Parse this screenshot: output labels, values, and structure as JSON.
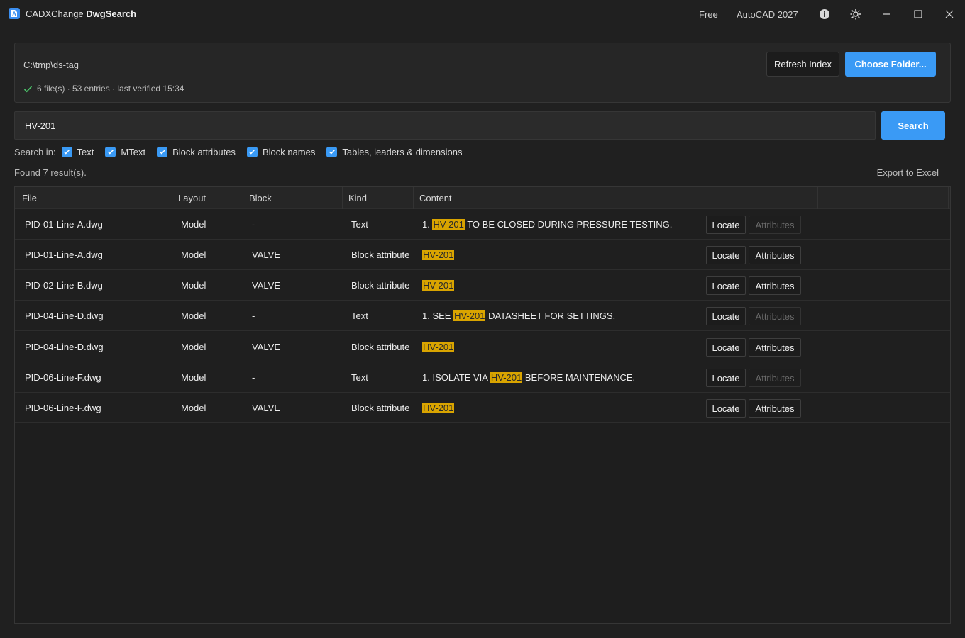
{
  "titlebar": {
    "brand": "CADXChange",
    "product": "DwgSearch",
    "plan": "Free",
    "host": "AutoCAD 2027",
    "icons": [
      "info-icon",
      "theme-icon",
      "minimize-icon",
      "maximize-icon",
      "close-icon"
    ]
  },
  "folder": {
    "path": "C:\\tmp\\ds-tag",
    "status": "6 file(s) · 53 entries · last verified 15:34",
    "refresh_label": "Refresh Index",
    "choose_label": "Choose Folder..."
  },
  "search": {
    "value": "HV-201",
    "button_label": "Search",
    "search_in_label": "Search in:",
    "options": [
      {
        "label": "Text",
        "checked": true
      },
      {
        "label": "MText",
        "checked": true
      },
      {
        "label": "Block attributes",
        "checked": true
      },
      {
        "label": "Block names",
        "checked": true
      },
      {
        "label": "Tables, leaders & dimensions",
        "checked": true
      }
    ]
  },
  "results": {
    "found_text": "Found 7 result(s).",
    "export_label": "Export to Excel",
    "columns": [
      "File",
      "Layout",
      "Block",
      "Kind",
      "Content",
      "",
      ""
    ],
    "locate_label": "Locate",
    "attributes_label": "Attributes",
    "highlight_color": "#d9a400",
    "rows": [
      {
        "file": "PID-01-Line-A.dwg",
        "layout": "Model",
        "block": "-",
        "kind": "Text",
        "content_pre": "1. ",
        "content_match": "HV-201",
        "content_post": " TO BE CLOSED DURING PRESSURE TESTING.",
        "attributes_enabled": false
      },
      {
        "file": "PID-01-Line-A.dwg",
        "layout": "Model",
        "block": "VALVE",
        "kind": "Block attribute",
        "content_pre": "",
        "content_match": "HV-201",
        "content_post": "",
        "attributes_enabled": true
      },
      {
        "file": "PID-02-Line-B.dwg",
        "layout": "Model",
        "block": "VALVE",
        "kind": "Block attribute",
        "content_pre": "",
        "content_match": "HV-201",
        "content_post": "",
        "attributes_enabled": true
      },
      {
        "file": "PID-04-Line-D.dwg",
        "layout": "Model",
        "block": "-",
        "kind": "Text",
        "content_pre": "1. SEE ",
        "content_match": "HV-201",
        "content_post": " DATASHEET FOR SETTINGS.",
        "attributes_enabled": false
      },
      {
        "file": "PID-04-Line-D.dwg",
        "layout": "Model",
        "block": "VALVE",
        "kind": "Block attribute",
        "content_pre": "",
        "content_match": "HV-201",
        "content_post": "",
        "attributes_enabled": true
      },
      {
        "file": "PID-06-Line-F.dwg",
        "layout": "Model",
        "block": "-",
        "kind": "Text",
        "content_pre": "1. ISOLATE VIA ",
        "content_match": "HV-201",
        "content_post": " BEFORE MAINTENANCE.",
        "attributes_enabled": false
      },
      {
        "file": "PID-06-Line-F.dwg",
        "layout": "Model",
        "block": "VALVE",
        "kind": "Block attribute",
        "content_pre": "",
        "content_match": "HV-201",
        "content_post": "",
        "attributes_enabled": true
      }
    ]
  }
}
